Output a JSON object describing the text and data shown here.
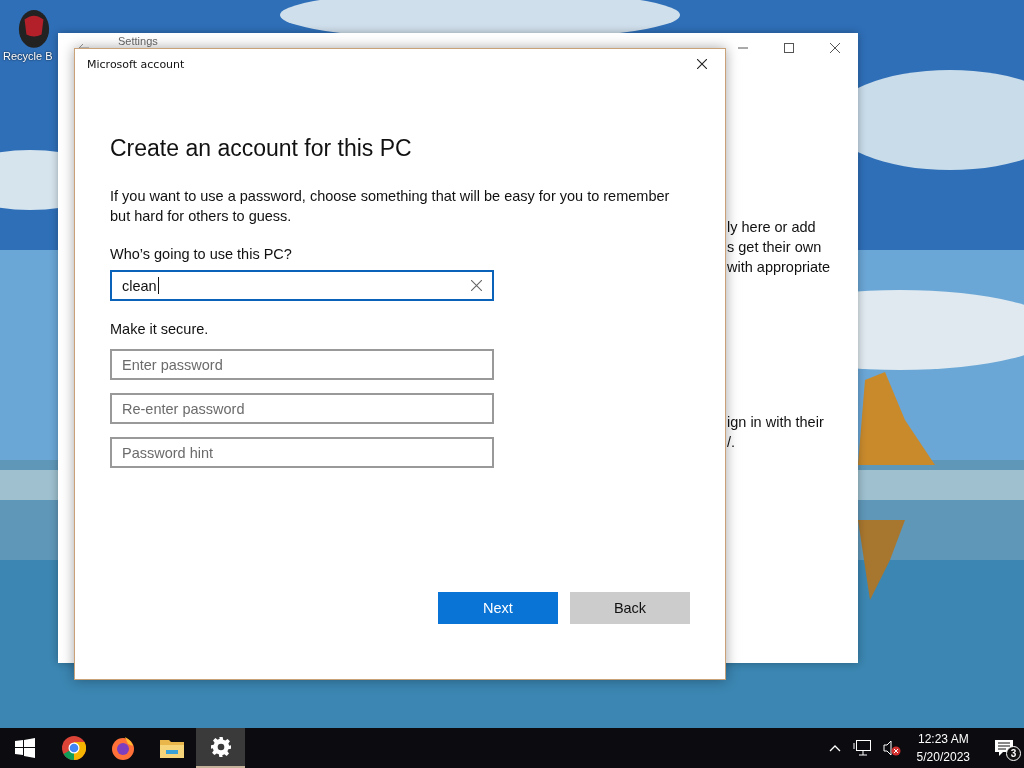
{
  "desktop": {
    "icons": [
      {
        "label": "Recycle B"
      }
    ]
  },
  "background_window": {
    "title": "Settings",
    "text_fragments": [
      {
        "text": "ly here or add"
      },
      {
        "text": "s get their own"
      },
      {
        "text": "with appropriate"
      },
      {
        "text": "ign in with their"
      },
      {
        "text": "/."
      }
    ]
  },
  "dialog": {
    "title": "Microsoft account",
    "heading": "Create an account for this PC",
    "description": "If you want to use a password, choose something that will be easy for you to remember but hard for others to guess.",
    "name_label": "Who’s going to use this PC?",
    "name_field": {
      "value": "clean"
    },
    "secure_label": "Make it secure.",
    "password_fields": [
      {
        "placeholder": "Enter password"
      },
      {
        "placeholder": "Re-enter password"
      },
      {
        "placeholder": "Password hint"
      }
    ],
    "buttons": [
      {
        "label": "Next",
        "kind": "primary"
      },
      {
        "label": "Back",
        "kind": "secondary"
      }
    ]
  },
  "taskbar": {
    "apps": [
      {
        "kind": "start",
        "selected": false
      },
      {
        "kind": "chrome",
        "selected": false
      },
      {
        "kind": "firefox",
        "selected": false
      },
      {
        "kind": "folder",
        "selected": false
      },
      {
        "kind": "settings",
        "selected": true
      }
    ],
    "time": "12:23 AM",
    "date": "5/20/2023",
    "notification_count": "3"
  }
}
